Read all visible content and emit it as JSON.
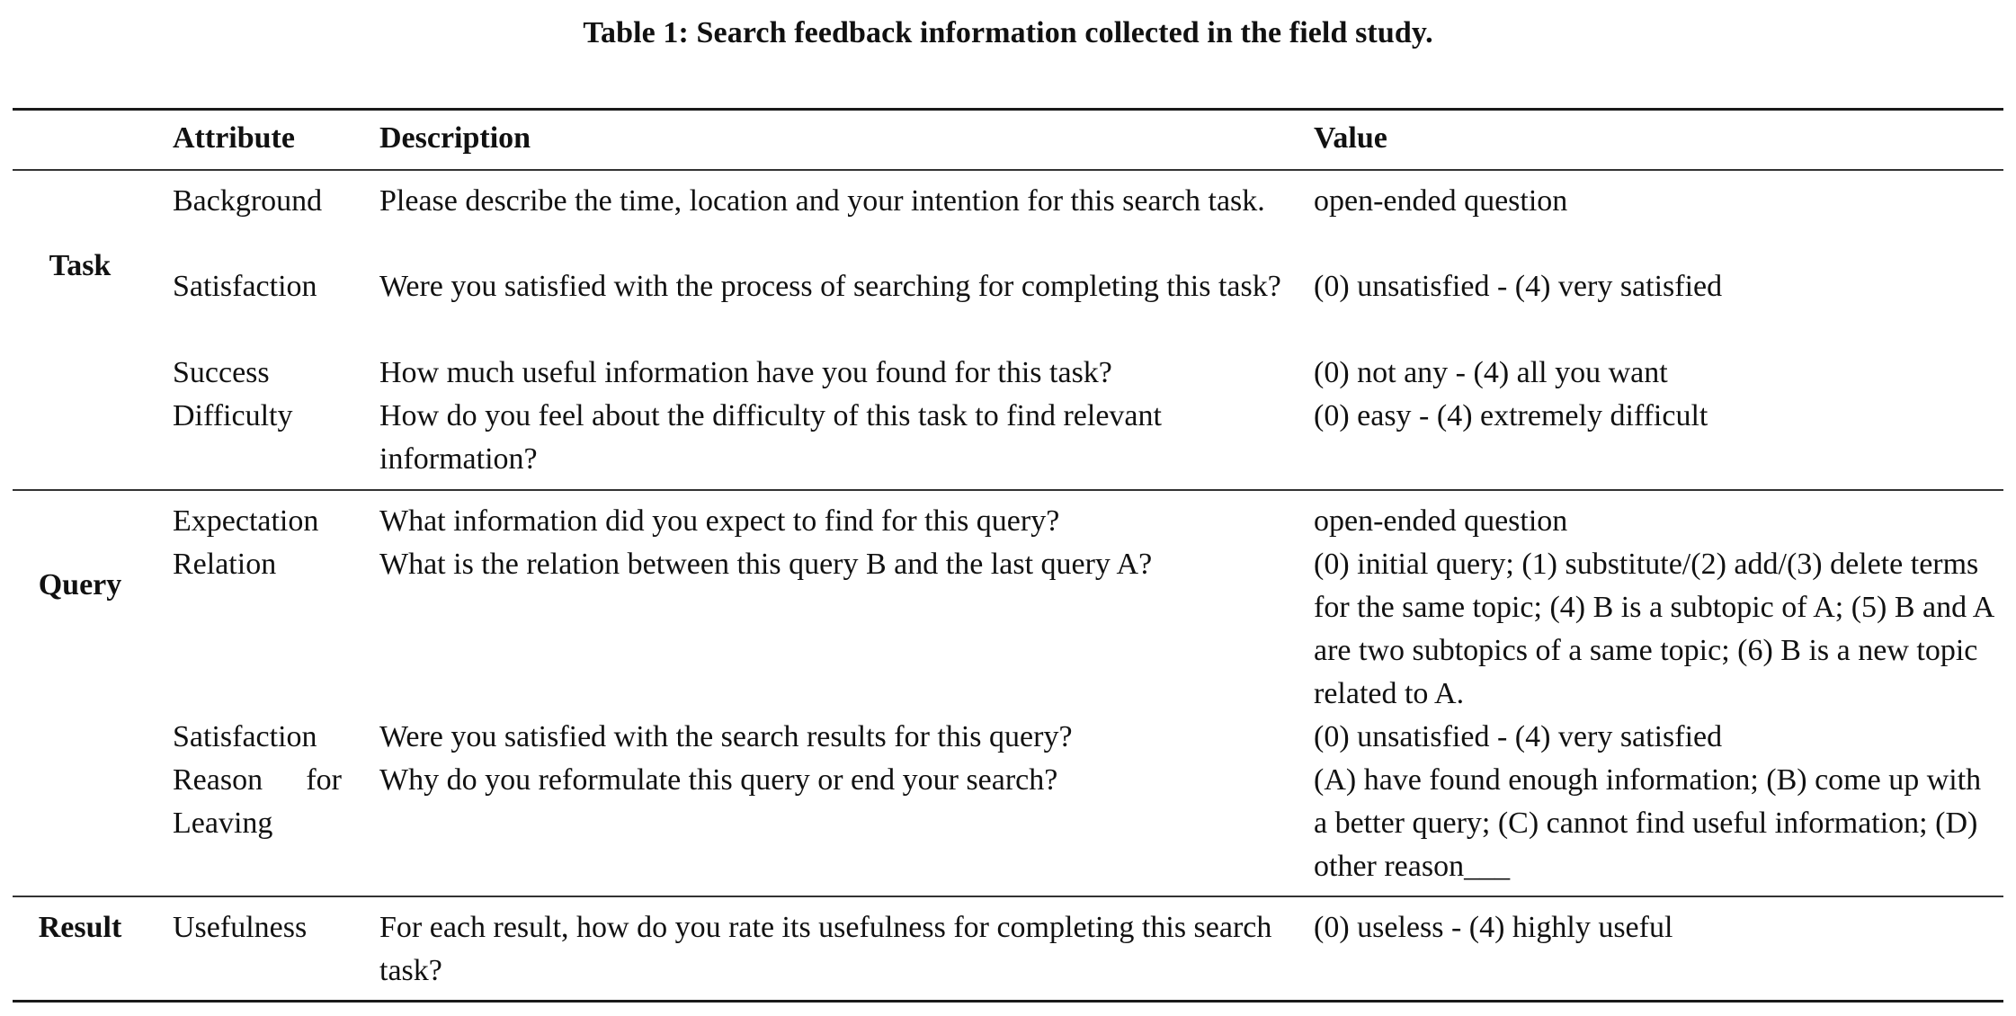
{
  "caption": "Table 1: Search feedback information collected in the field study.",
  "table": {
    "headers": {
      "group": "",
      "attribute": "Attribute",
      "description": "Description",
      "value": "Value"
    },
    "groups": [
      {
        "name": "Task",
        "rows": [
          {
            "attribute": "Background",
            "description": "Please describe the time, location and your intention for this search task.",
            "value": "open-ended question"
          },
          {
            "attribute": "Satisfaction",
            "description": "Were you satisfied with the process of searching for completing this task?",
            "value": "(0) unsatisfied - (4) very satisfied"
          },
          {
            "attribute": "Success",
            "description": "How much useful information have you found for this task?",
            "value": "(0) not any - (4) all you want"
          },
          {
            "attribute": "Difficulty",
            "description": "How do you feel about the difficulty of this task to find relevant information?",
            "value": "(0) easy - (4) extremely difficult"
          }
        ]
      },
      {
        "name": "Query",
        "rows": [
          {
            "attribute": "Expectation",
            "description": "What information did you expect to find for this query?",
            "value": "open-ended question"
          },
          {
            "attribute": "Relation",
            "description": "What is the relation between this query B and the last query A?",
            "value": "(0) initial query; (1) substitute/(2) add/(3) delete terms for the same topic; (4) B is a subtopic of A; (5) B and A are two subtopics of a same topic; (6) B is a new topic related to A."
          },
          {
            "attribute": "Satisfaction",
            "description": "Were you satisfied with the search results for this query?",
            "value": "(0) unsatisfied - (4) very satisfied"
          },
          {
            "attribute": "Reason for Leaving",
            "description": "Why do you reformulate this query or end your search?",
            "value": "(A) have found enough information; (B) come up with a better query; (C) cannot find useful information; (D) other reason___"
          }
        ]
      },
      {
        "name": "Result",
        "rows": [
          {
            "attribute": "Usefulness",
            "description": "For each result, how do you rate its usefulness for completing this search task?",
            "value": "(0) useless - (4) highly useful"
          }
        ]
      }
    ]
  }
}
